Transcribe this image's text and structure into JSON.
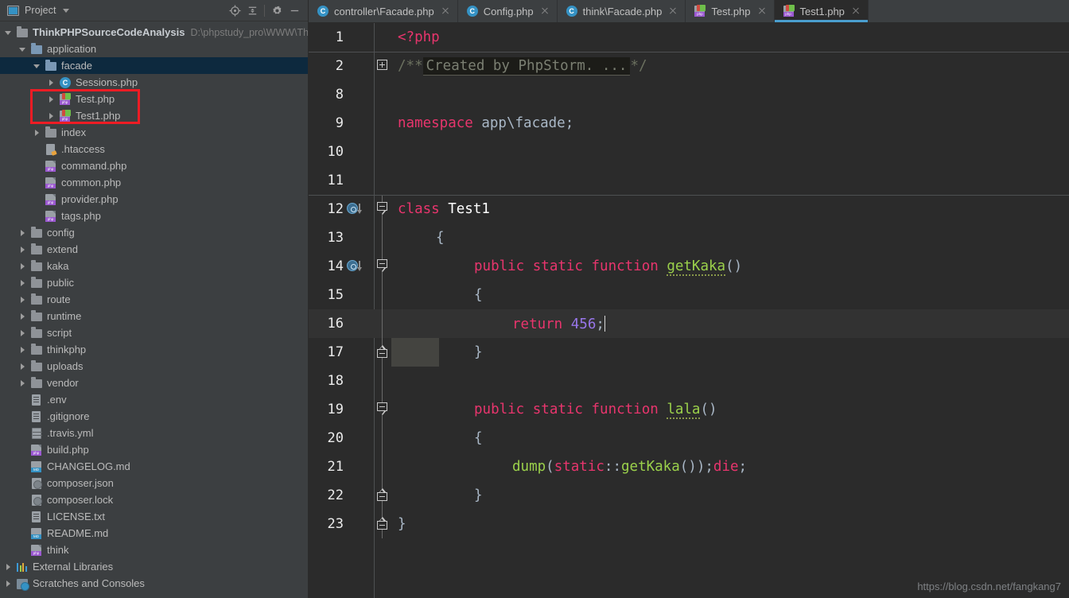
{
  "sidebar": {
    "header": {
      "title": "Project",
      "icons": [
        "project-icon",
        "chevron-down-icon",
        "locate-icon",
        "collapse-all-icon",
        "gear-icon",
        "minimize-icon"
      ]
    },
    "items": [
      {
        "label": "ThinkPHPSourceCodeAnalysis",
        "path": "D:\\phpstudy_pro\\WWW\\Th",
        "icon": "folder-icon",
        "arrow": "down",
        "indent": 0,
        "bold": true,
        "selected": false
      },
      {
        "label": "application",
        "path": "",
        "icon": "folder-blue-icon",
        "arrow": "down",
        "indent": 1,
        "bold": false,
        "selected": false
      },
      {
        "label": "facade",
        "path": "",
        "icon": "folder-blue-icon",
        "arrow": "down",
        "indent": 2,
        "bold": false,
        "selected": true
      },
      {
        "label": "Sessions.php",
        "path": "",
        "icon": "class-icon",
        "arrow": "right",
        "indent": 3,
        "bold": false,
        "selected": false
      },
      {
        "label": "Test.php",
        "path": "",
        "icon": "php-runnable-icon",
        "arrow": "right",
        "indent": 3,
        "bold": false,
        "selected": false
      },
      {
        "label": "Test1.php",
        "path": "",
        "icon": "php-runnable-icon",
        "arrow": "right",
        "indent": 3,
        "bold": false,
        "selected": false
      },
      {
        "label": "index",
        "path": "",
        "icon": "folder-icon",
        "arrow": "right",
        "indent": 2,
        "bold": false,
        "selected": false
      },
      {
        "label": ".htaccess",
        "path": "",
        "icon": "htaccess-icon",
        "arrow": "none",
        "indent": 2,
        "bold": false,
        "selected": false
      },
      {
        "label": "command.php",
        "path": "",
        "icon": "php-icon",
        "arrow": "none",
        "indent": 2,
        "bold": false,
        "selected": false
      },
      {
        "label": "common.php",
        "path": "",
        "icon": "php-icon",
        "arrow": "none",
        "indent": 2,
        "bold": false,
        "selected": false
      },
      {
        "label": "provider.php",
        "path": "",
        "icon": "php-icon",
        "arrow": "none",
        "indent": 2,
        "bold": false,
        "selected": false
      },
      {
        "label": "tags.php",
        "path": "",
        "icon": "php-icon",
        "arrow": "none",
        "indent": 2,
        "bold": false,
        "selected": false
      },
      {
        "label": "config",
        "path": "",
        "icon": "folder-icon",
        "arrow": "right",
        "indent": 1,
        "bold": false,
        "selected": false
      },
      {
        "label": "extend",
        "path": "",
        "icon": "folder-icon",
        "arrow": "right",
        "indent": 1,
        "bold": false,
        "selected": false
      },
      {
        "label": "kaka",
        "path": "",
        "icon": "folder-icon",
        "arrow": "right",
        "indent": 1,
        "bold": false,
        "selected": false
      },
      {
        "label": "public",
        "path": "",
        "icon": "folder-icon",
        "arrow": "right",
        "indent": 1,
        "bold": false,
        "selected": false
      },
      {
        "label": "route",
        "path": "",
        "icon": "folder-icon",
        "arrow": "right",
        "indent": 1,
        "bold": false,
        "selected": false
      },
      {
        "label": "runtime",
        "path": "",
        "icon": "folder-icon",
        "arrow": "right",
        "indent": 1,
        "bold": false,
        "selected": false
      },
      {
        "label": "script",
        "path": "",
        "icon": "folder-icon",
        "arrow": "right",
        "indent": 1,
        "bold": false,
        "selected": false
      },
      {
        "label": "thinkphp",
        "path": "",
        "icon": "folder-icon",
        "arrow": "right",
        "indent": 1,
        "bold": false,
        "selected": false
      },
      {
        "label": "uploads",
        "path": "",
        "icon": "folder-icon",
        "arrow": "right",
        "indent": 1,
        "bold": false,
        "selected": false
      },
      {
        "label": "vendor",
        "path": "",
        "icon": "folder-icon",
        "arrow": "right",
        "indent": 1,
        "bold": false,
        "selected": false
      },
      {
        "label": ".env",
        "path": "",
        "icon": "text-file-icon",
        "arrow": "none",
        "indent": 1,
        "bold": false,
        "selected": false
      },
      {
        "label": ".gitignore",
        "path": "",
        "icon": "text-file-icon",
        "arrow": "none",
        "indent": 1,
        "bold": false,
        "selected": false
      },
      {
        "label": ".travis.yml",
        "path": "",
        "icon": "yaml-file-icon",
        "arrow": "none",
        "indent": 1,
        "bold": false,
        "selected": false
      },
      {
        "label": "build.php",
        "path": "",
        "icon": "php-icon",
        "arrow": "none",
        "indent": 1,
        "bold": false,
        "selected": false
      },
      {
        "label": "CHANGELOG.md",
        "path": "",
        "icon": "markdown-file-icon",
        "arrow": "none",
        "indent": 1,
        "bold": false,
        "selected": false
      },
      {
        "label": "composer.json",
        "path": "",
        "icon": "composer-file-icon",
        "arrow": "none",
        "indent": 1,
        "bold": false,
        "selected": false
      },
      {
        "label": "composer.lock",
        "path": "",
        "icon": "composer-file-icon",
        "arrow": "none",
        "indent": 1,
        "bold": false,
        "selected": false
      },
      {
        "label": "LICENSE.txt",
        "path": "",
        "icon": "text-file-icon",
        "arrow": "none",
        "indent": 1,
        "bold": false,
        "selected": false
      },
      {
        "label": "README.md",
        "path": "",
        "icon": "markdown-file-icon",
        "arrow": "none",
        "indent": 1,
        "bold": false,
        "selected": false
      },
      {
        "label": "think",
        "path": "",
        "icon": "php-icon",
        "arrow": "none",
        "indent": 1,
        "bold": false,
        "selected": false
      },
      {
        "label": "External Libraries",
        "path": "",
        "icon": "libraries-icon",
        "arrow": "right",
        "indent": 0,
        "bold": false,
        "selected": false
      },
      {
        "label": "Scratches and Consoles",
        "path": "",
        "icon": "scratches-icon",
        "arrow": "right",
        "indent": 0,
        "bold": false,
        "selected": false
      }
    ],
    "annotation": {
      "color": "#ee1c24",
      "label": "red-highlight-box"
    }
  },
  "tabs": [
    {
      "label": "controller\\Facade.php",
      "icon": "class-icon",
      "active": false
    },
    {
      "label": "Config.php",
      "icon": "class-icon",
      "active": false
    },
    {
      "label": "think\\Facade.php",
      "icon": "class-icon",
      "active": false
    },
    {
      "label": "Test.php",
      "icon": "php-runnable-icon",
      "active": false
    },
    {
      "label": "Test1.php",
      "icon": "php-runnable-icon",
      "active": true
    }
  ],
  "editor": {
    "active_line": 16,
    "accent_color": "#4a9ece",
    "background": "#2b2b2b",
    "lines": [
      {
        "num": "1",
        "fold": "none",
        "gutter": "none",
        "cur": false
      },
      {
        "num": "2",
        "fold": "plus",
        "gutter": "none",
        "cur": false
      },
      {
        "num": "8",
        "fold": "none",
        "gutter": "none",
        "cur": false
      },
      {
        "num": "9",
        "fold": "none",
        "gutter": "none",
        "cur": false
      },
      {
        "num": "10",
        "fold": "none",
        "gutter": "none",
        "cur": false
      },
      {
        "num": "11",
        "fold": "none",
        "gutter": "none",
        "cur": false
      },
      {
        "num": "12",
        "fold": "start",
        "gutter": "override",
        "cur": false
      },
      {
        "num": "13",
        "fold": "none",
        "gutter": "none",
        "cur": false
      },
      {
        "num": "14",
        "fold": "start",
        "gutter": "override",
        "cur": false
      },
      {
        "num": "15",
        "fold": "none",
        "gutter": "none",
        "cur": false
      },
      {
        "num": "16",
        "fold": "none",
        "gutter": "none",
        "cur": true
      },
      {
        "num": "17",
        "fold": "end",
        "gutter": "none",
        "cur": false
      },
      {
        "num": "18",
        "fold": "none",
        "gutter": "none",
        "cur": false
      },
      {
        "num": "19",
        "fold": "start",
        "gutter": "none",
        "cur": false
      },
      {
        "num": "20",
        "fold": "none",
        "gutter": "none",
        "cur": false
      },
      {
        "num": "21",
        "fold": "none",
        "gutter": "none",
        "cur": false
      },
      {
        "num": "22",
        "fold": "end",
        "gutter": "none",
        "cur": false
      },
      {
        "num": "23",
        "fold": "end",
        "gutter": "none",
        "cur": false
      }
    ],
    "code": {
      "l1_php_open": "<?php",
      "l2_comment_open": "/**",
      "l2_fold_placeholder": "Created by PhpStorm. ...",
      "l2_comment_close": "*/",
      "l9_namespace_kw": "namespace",
      "l9_namespace_value": " app\\facade;",
      "l12_class_kw": "class",
      "l12_class_name": " Test1",
      "l13_brace": "{",
      "l14_modifiers": "public static function ",
      "l14_method": "getKaka",
      "l14_parens": "()",
      "l15_brace": "{",
      "l16_return_kw": "return",
      "l16_value": "456",
      "l16_semi": ";",
      "l17_brace": "}",
      "l19_modifiers": "public static function ",
      "l19_method": "lala",
      "l19_parens": "()",
      "l20_brace": "{",
      "l21_dump": "dump",
      "l21_open": "(",
      "l21_static": "static",
      "l21_scope": "::",
      "l21_call": "getKaka",
      "l21_close": "());",
      "l21_die": "die",
      "l21_semi": ";",
      "l22_brace": "}",
      "l23_brace": "}"
    }
  },
  "watermark": "https://blog.csdn.net/fangkang7"
}
